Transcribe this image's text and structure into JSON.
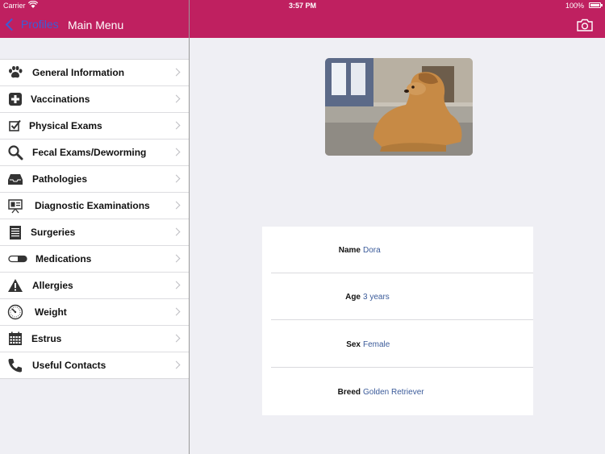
{
  "status": {
    "carrier": "Carrier",
    "time": "3:57 PM",
    "battery": "100%"
  },
  "nav": {
    "back_label": "Profiles",
    "title": "Main Menu"
  },
  "menu": [
    {
      "label": "General Information",
      "icon": "paw-icon"
    },
    {
      "label": "Vaccinations",
      "icon": "plus-cross-icon"
    },
    {
      "label": "Physical Exams",
      "icon": "checkbox-icon"
    },
    {
      "label": "Fecal Exams/Deworming",
      "icon": "magnifier-icon"
    },
    {
      "label": "Pathologies",
      "icon": "tray-icon"
    },
    {
      "label": "Diagnostic Examinations",
      "icon": "presentation-board-icon"
    },
    {
      "label": "Surgeries",
      "icon": "notepad-icon"
    },
    {
      "label": "Medications",
      "icon": "pill-icon"
    },
    {
      "label": "Allergies",
      "icon": "warning-icon"
    },
    {
      "label": "Weight",
      "icon": "scale-gauge-icon"
    },
    {
      "label": "Estrus",
      "icon": "calendar-icon"
    },
    {
      "label": "Useful Contacts",
      "icon": "phone-icon"
    }
  ],
  "profile": {
    "rows": [
      {
        "label": "Name",
        "value": "Dora"
      },
      {
        "label": "Age",
        "value": "3 years"
      },
      {
        "label": "Sex",
        "value": "Female"
      },
      {
        "label": "Breed",
        "value": "Golden Retriever"
      }
    ]
  },
  "colors": {
    "brand": "#bf2060",
    "link": "#3a5ed8",
    "value_text": "#3b5b9a"
  }
}
